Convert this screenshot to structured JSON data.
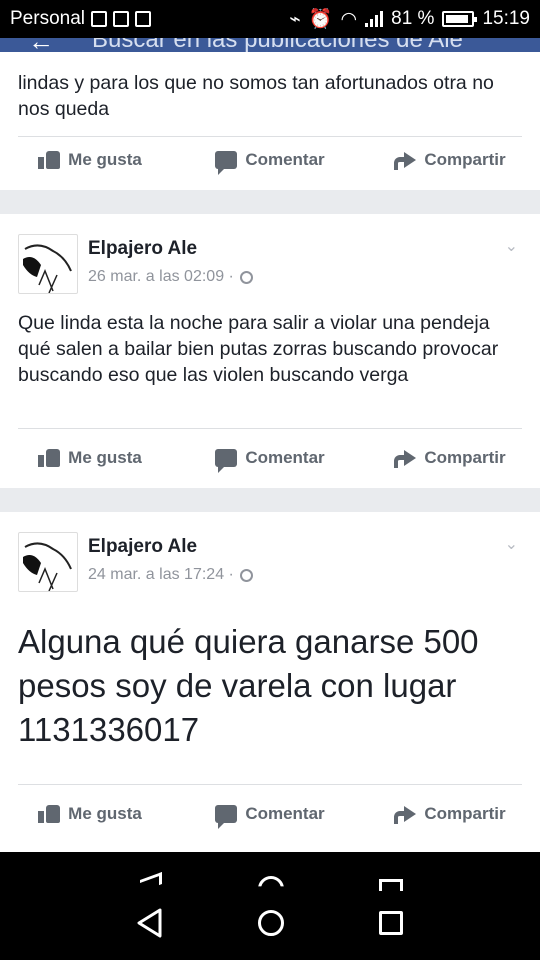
{
  "status_bar": {
    "carrier": "Personal",
    "battery": "81 %",
    "time": "15:19",
    "battery_level": 0.81
  },
  "header": {
    "search_text": "Buscar en las publicaciones de Ale"
  },
  "posts": [
    {
      "text": "lindas y para los que no somos tan afortunados otra no nos queda",
      "actions": {
        "like": "Me gusta",
        "comment": "Comentar",
        "share": "Compartir"
      }
    },
    {
      "author": "Elpajero Ale",
      "time": "26 mar. a las 02:09 ·",
      "text": "Que linda esta la noche para salir a violar una pendeja qué salen a bailar bien putas zorras buscando provocar buscando eso que las violen buscando verga",
      "actions": {
        "like": "Me gusta",
        "comment": "Comentar",
        "share": "Compartir"
      }
    },
    {
      "author": "Elpajero Ale",
      "time": "24 mar. a las 17:24 ·",
      "text": "Alguna qué quiera ganarse 500 pesos soy de varela con lugar 1131336017",
      "actions": {
        "like": "Me gusta",
        "comment": "Comentar",
        "share": "Compartir"
      }
    }
  ],
  "icons": {
    "post_menu": "chevron-down-icon",
    "privacy": "globe-icon",
    "like": "thumbs-up-icon",
    "comment": "comment-icon",
    "share": "share-arrow-icon"
  },
  "colors": {
    "header": "#3b5998",
    "feed_bg": "#e9ebee",
    "action_text": "#606770",
    "meta_text": "#90949c"
  }
}
